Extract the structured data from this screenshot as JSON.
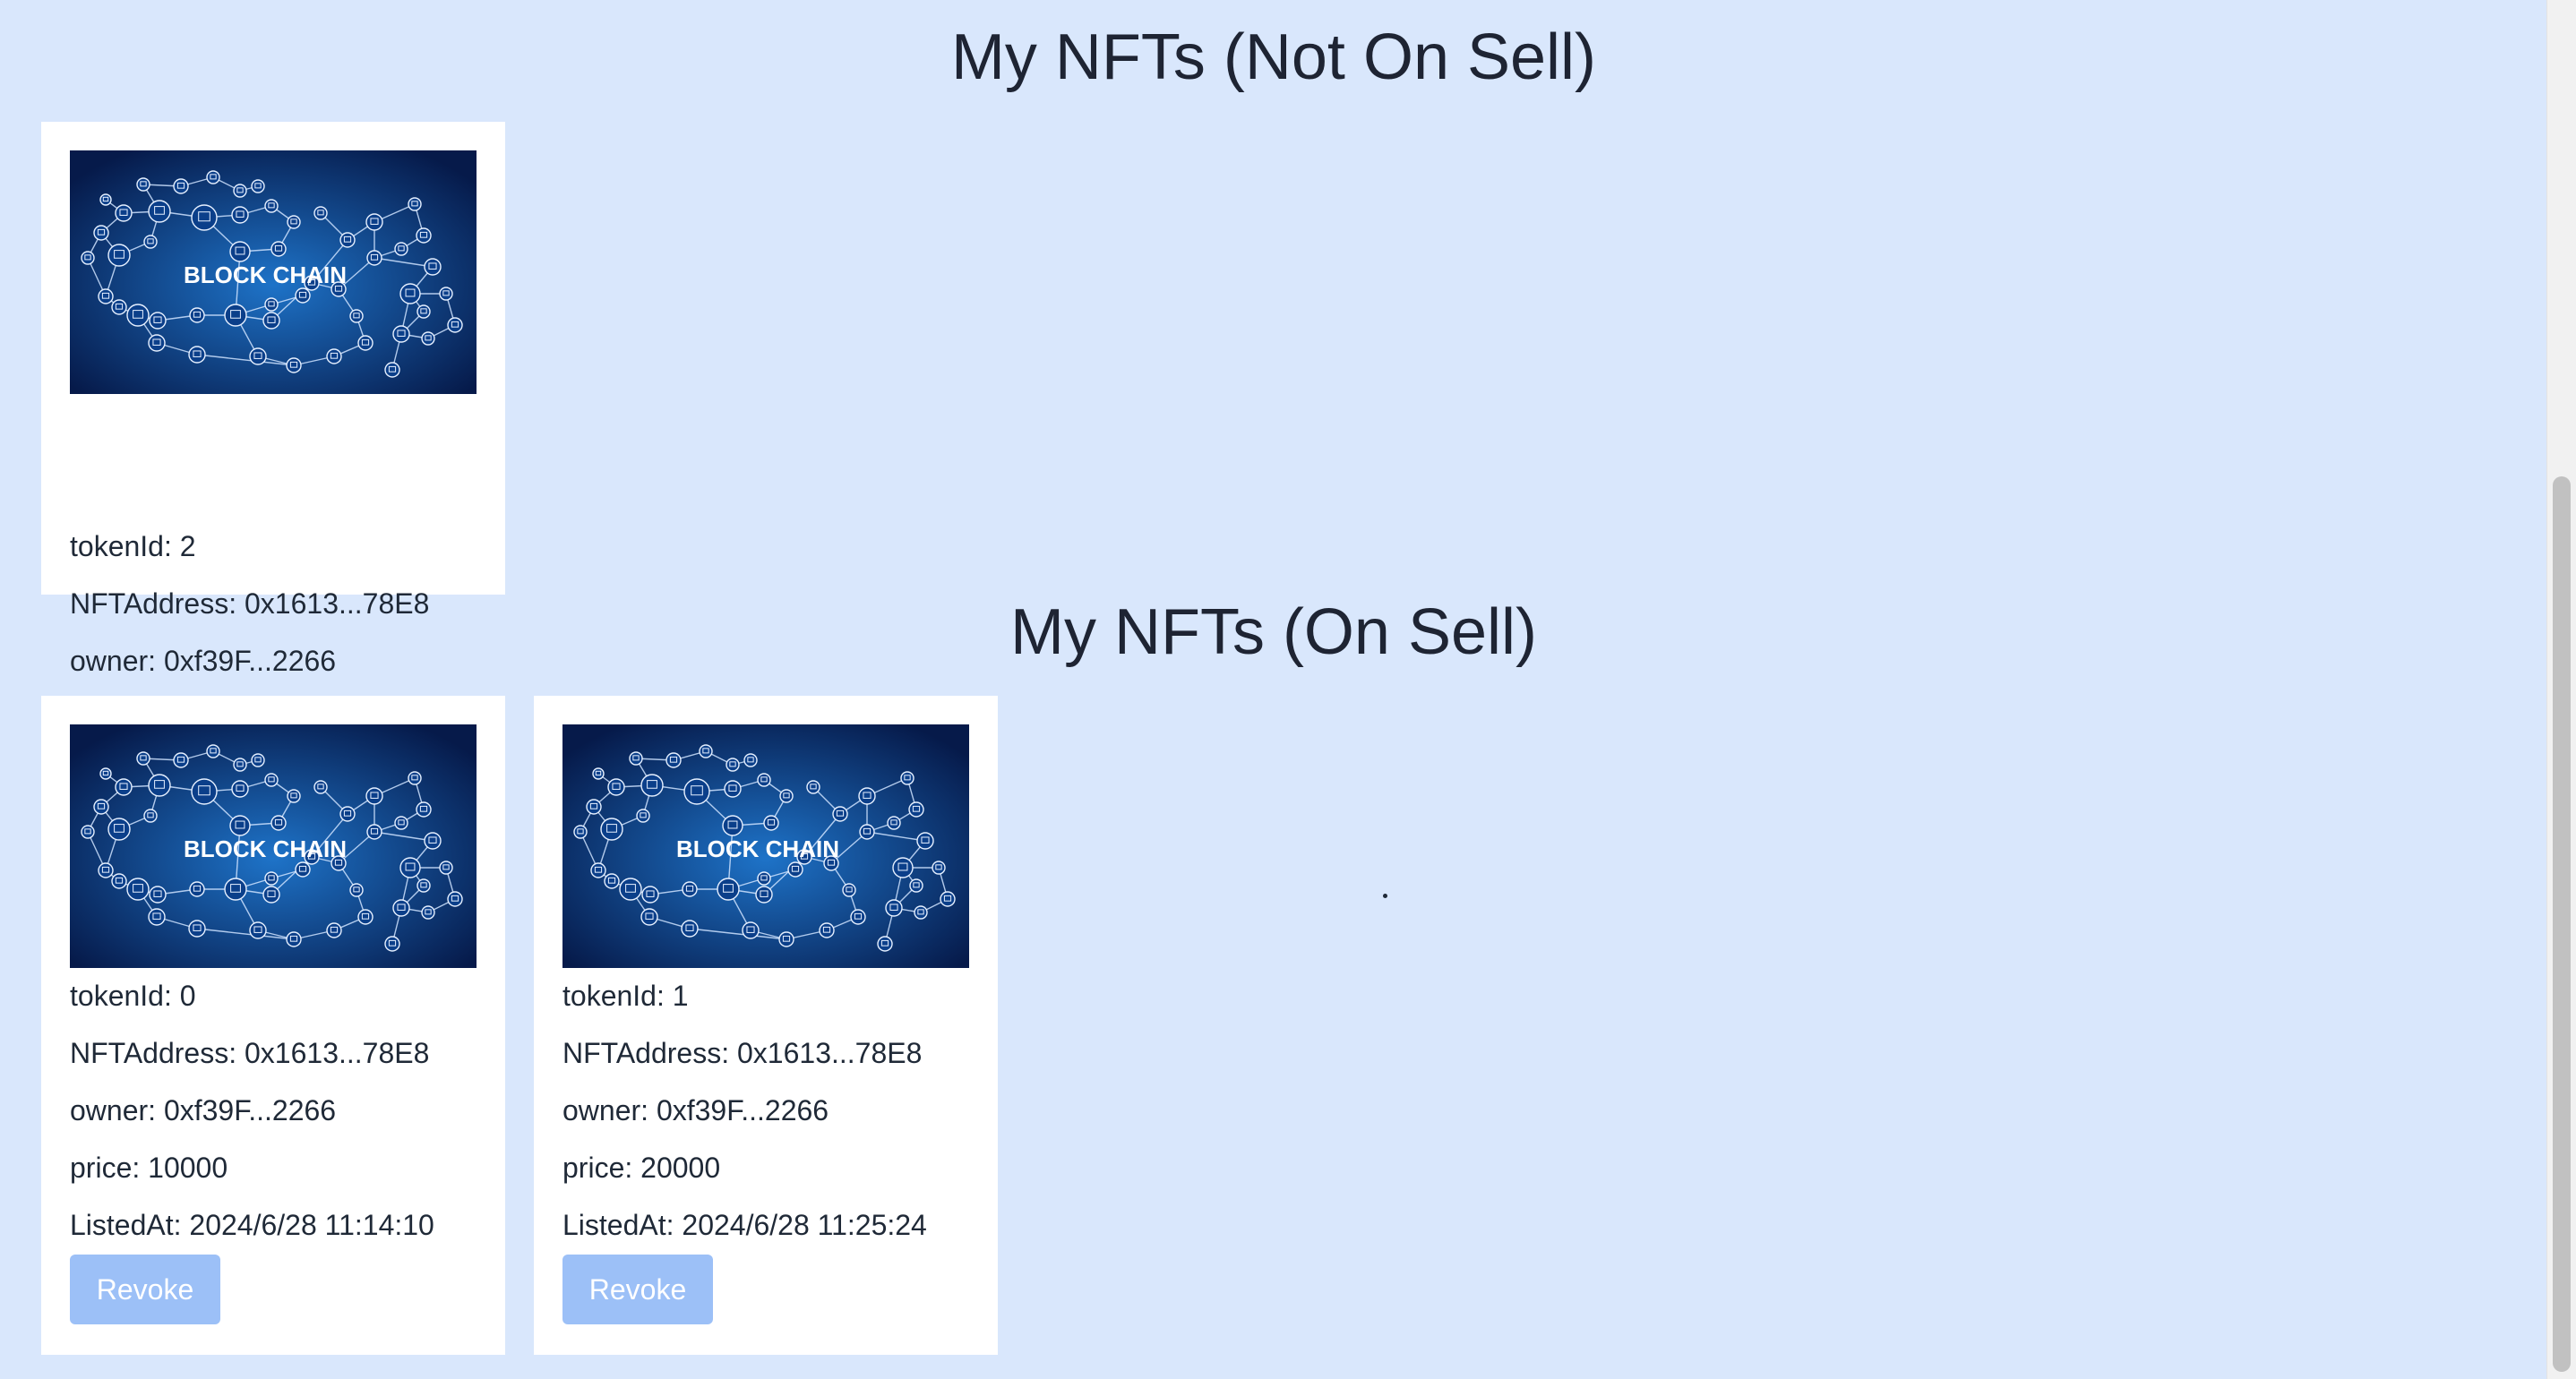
{
  "sections": {
    "not_on_sell": {
      "title": "My NFTs (Not On Sell)",
      "cards": [
        {
          "image_text": "BLOCK CHAIN",
          "tokenId": "tokenId: 2",
          "nftAddress": "NFTAddress: 0x1613...78E8",
          "owner": "owner: 0xf39F...2266"
        }
      ]
    },
    "on_sell": {
      "title": "My NFTs (On Sell)",
      "cards": [
        {
          "image_text": "BLOCK CHAIN",
          "tokenId": "tokenId: 0",
          "nftAddress": "NFTAddress: 0x1613...78E8",
          "owner": "owner: 0xf39F...2266",
          "price": "price: 10000",
          "listedAt": "ListedAt: 2024/6/28 11:14:10",
          "revoke_label": "Revoke"
        },
        {
          "image_text": "BLOCK CHAIN",
          "tokenId": "tokenId: 1",
          "nftAddress": "NFTAddress: 0x1613...78E8",
          "owner": "owner: 0xf39F...2266",
          "price": "price: 20000",
          "listedAt": "ListedAt: 2024/6/28 11:25:24",
          "revoke_label": "Revoke"
        }
      ]
    }
  },
  "colors": {
    "page_background": "#d9e7fc",
    "card_background": "#ffffff",
    "revoke_button": "#9cc0f7",
    "image_dark": "#061a4a",
    "image_light": "#1e73c8"
  },
  "icons": {
    "nft_image": "blockchain-network-image"
  }
}
